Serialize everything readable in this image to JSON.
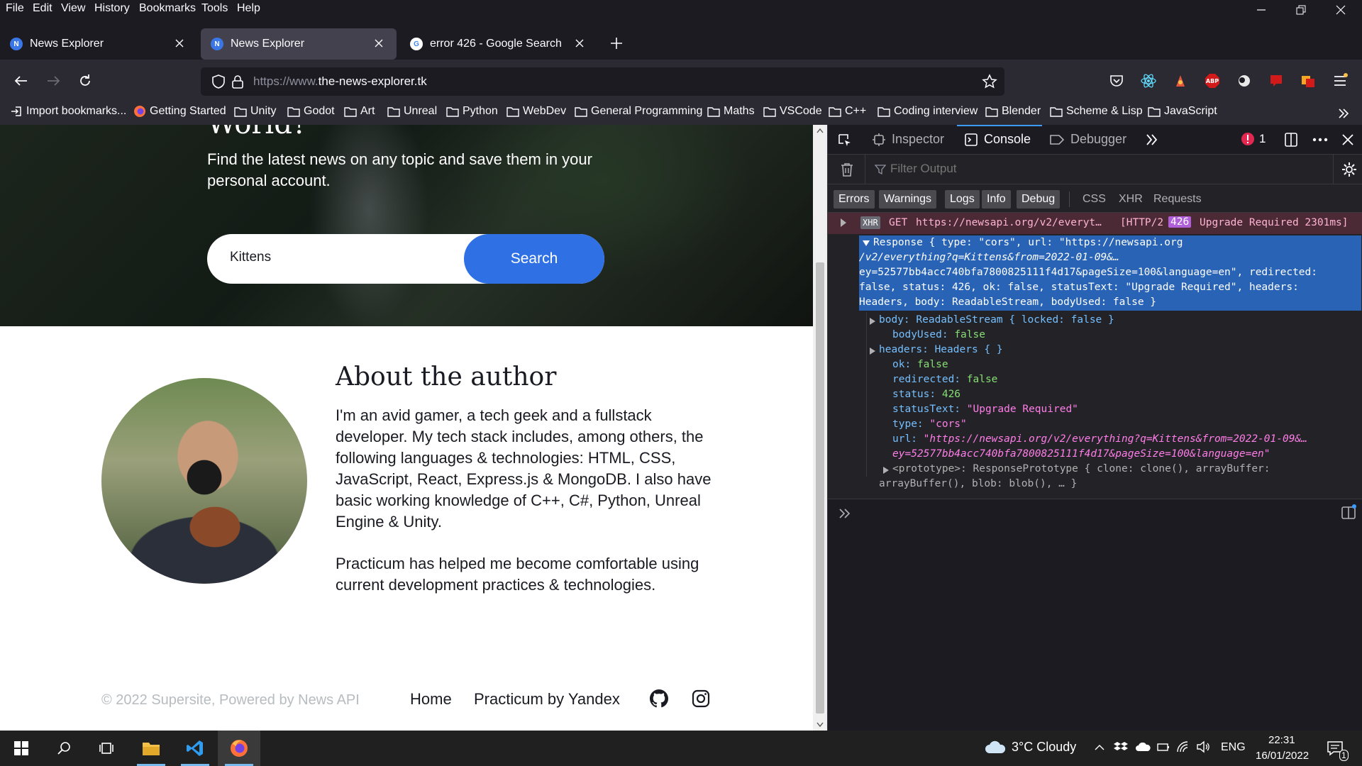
{
  "menu": {
    "items": [
      "File",
      "Edit",
      "View",
      "History",
      "Bookmarks",
      "Tools",
      "Help"
    ]
  },
  "tabs": [
    {
      "title": "News Explorer",
      "favicon": "N",
      "active": false
    },
    {
      "title": "News Explorer",
      "favicon": "N",
      "active": true
    },
    {
      "title": "error 426 - Google Search",
      "favicon": "G",
      "active": false
    }
  ],
  "urlbar": {
    "prefix": "https://www.",
    "domain": "the-news-explorer.tk"
  },
  "bookmarks": [
    "Import bookmarks...",
    "Getting Started",
    "Unity",
    "Godot",
    "Art",
    "Unreal",
    "Python",
    "WebDev",
    "General Programming",
    "Maths",
    "VSCode",
    "C++",
    "Coding interview",
    "Blender",
    "Scheme & Lisp",
    "JavaScript"
  ],
  "page": {
    "hero": {
      "title_fragment": "World?",
      "subtitle": "Find the latest news on any topic and save them in your personal account.",
      "search_value": "Kittens",
      "search_button": "Search"
    },
    "about": {
      "title": "About the author",
      "p1": "I'm an avid gamer, a tech geek and a fullstack developer. My tech stack includes, among others, the following languages & technologies: HTML, CSS, JavaScript, React, Express.js & MongoDB. I also have basic working knowledge of C++, C#, Python, Unreal Engine & Unity.",
      "p2": "Practicum has helped me become comfortable using current development practices & technologies."
    },
    "footer": {
      "copyright": "© 2022 Supersite, Powered by News API",
      "links": [
        "Home",
        "Practicum by Yandex"
      ]
    }
  },
  "devtools": {
    "tabs": [
      "Inspector",
      "Console",
      "Debugger"
    ],
    "error_count": "1",
    "filter_placeholder": "Filter Output",
    "categories": [
      "Errors",
      "Warnings",
      "Logs",
      "Info",
      "Debug",
      "CSS",
      "XHR",
      "Requests"
    ],
    "xhr": {
      "badge": "XHR",
      "method": "GET",
      "url": "https://newsapi.org/v2/everyt…",
      "protocol": "[HTTP/2",
      "status": "426",
      "status_text": "Upgrade Required 2301ms]"
    },
    "response_summary": [
      "Response { type: \"cors\", url: \"https://newsapi.org",
      "/v2/everything?q=Kittens&from=2022-01-09&…",
      "ey=52577bb4acc740bfa7800825111f4d17&pageSize=100&language=en\", redirected:",
      "false, status: 426, ok: false, statusText: \"Upgrade Required\", headers:",
      "Headers, body: ReadableStream, bodyUsed: false }"
    ],
    "props": {
      "body_key": "body:",
      "body_val": "ReadableStream { locked: false }",
      "bodyUsed_key": "bodyUsed:",
      "bodyUsed_val": "false",
      "headers_key": "headers:",
      "headers_val": "Headers {  }",
      "ok_key": "ok:",
      "ok_val": "false",
      "redirected_key": "redirected:",
      "redirected_val": "false",
      "status_key": "status:",
      "status_val": "426",
      "statusText_key": "statusText:",
      "statusText_val": "\"Upgrade Required\"",
      "type_key": "type:",
      "type_val": "\"cors\"",
      "url_key": "url:",
      "url_val1": "\"https://newsapi.org/v2/everything?q=Kittens&from=2022-01-09&…",
      "url_val2": "ey=52577bb4acc740bfa7800825111f4d17&pageSize=100&language=en\"",
      "prototype_line1": "<prototype>: ResponsePrototype { clone: clone(), arrayBuffer:",
      "prototype_line2": "arrayBuffer(), blob: blob(), … }"
    }
  },
  "taskbar": {
    "weather": "3°C  Cloudy",
    "lang": "ENG",
    "time": "22:31",
    "date": "16/01/2022",
    "notif_count": "1"
  },
  "colors": {
    "accent": "#2f71e5",
    "devtools_bg": "#232327",
    "error_row": "#4b2a35",
    "selection": "#2863b5"
  }
}
